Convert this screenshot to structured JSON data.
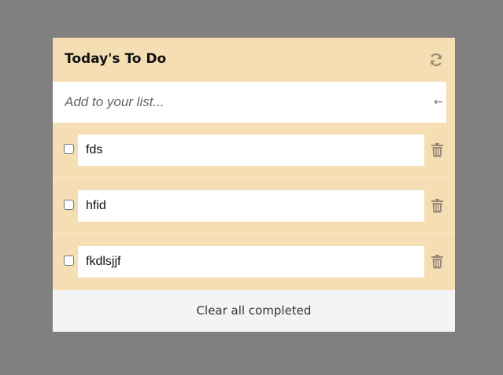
{
  "header": {
    "title": "Today's To Do",
    "refresh_icon": "refresh-icon"
  },
  "add": {
    "placeholder": "Add to your list...",
    "value": "",
    "enter_icon": "←"
  },
  "items": [
    {
      "text": "fds",
      "checked": false
    },
    {
      "text": "hfid",
      "checked": false
    },
    {
      "text": "fkdlsjjf",
      "checked": false
    }
  ],
  "footer": {
    "clear_label": "Clear all completed"
  },
  "colors": {
    "background": "#808080",
    "card": "#f5deb3",
    "icon": "#9b8a76",
    "footer": "#f4f4f4"
  }
}
